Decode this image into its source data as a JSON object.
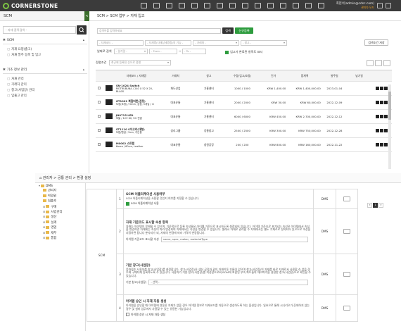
{
  "header": {
    "logo_text": "CORNERSTONE",
    "user_name": "최현석(admin@cdsc.com)",
    "user_sub": "관리자 모드",
    "menu_icons": [
      "grid-icon",
      "monitor-icon",
      "doc-icon",
      "truck-icon",
      "box-icon",
      "chart-icon",
      "calendar-icon",
      "money-icon",
      "car-icon",
      "people-icon",
      "layers-icon",
      "cart-icon",
      "gear-icon",
      "user-icon",
      "message-icon"
    ],
    "accent": "#2e9c3e",
    "bg": "#3b3b3b"
  },
  "left": {
    "title": "SCM",
    "collapse_tab": "<",
    "search_placeholder": "- 자재 품목검색 -",
    "sections": [
      {
        "label": "SCM",
        "items": [
          {
            "label": "자재 요청(출고)"
          },
          {
            "label": "자재 발주 등록 및 입고"
          }
        ]
      },
      {
        "label": "기초 정보 관리",
        "items": [
          {
            "label": "자재 관리"
          },
          {
            "label": "거래처 관리"
          },
          {
            "label": "창고(사업장) 관리"
          },
          {
            "label": "입출고 관리"
          }
        ]
      }
    ]
  },
  "breadcrumb": "SCM > SCM 업무 > 자재 입고",
  "filters": {
    "search_placeholder": "검색어를 입력하세요",
    "search_btn": "검색",
    "register_btn": "신규등록",
    "f1": "- 자재코드 -",
    "f2": "- 자재명(자재상세명칭)의 기능 -",
    "f3": "- 거래처 -",
    "f4": "- 창고 -",
    "reset_btn": "검색조건 저장",
    "date_label": "날짜로 검색",
    "date_sel": "- 날기일 -",
    "from": "- From -",
    "tilde": "~",
    "to": "- To -",
    "chk_label": "입고가 완료된 항목도 표시",
    "sort_label": "정렬조건",
    "sort_sel": "최근에 등록된 순으로 정렬",
    "tool_icons": [
      "refresh-icon",
      "print-icon",
      "excel-icon"
    ]
  },
  "table": {
    "headers": [
      "",
      "",
      "자재코드 / 자재명",
      "거래처",
      "창고",
      "수량(입고/요청)",
      "단가",
      "합계액",
      "발주일",
      "납기일",
      ""
    ],
    "rows": [
      {
        "code": "SN-1024 Switch",
        "name": "MOTRUBUNA / 240 X 52 X 20, BLACK",
        "vendor": "화도산업",
        "wh": "기흥센터",
        "qty": "1000 / 1000",
        "price": "KRW 1,400.00",
        "total": "KRW 1,400,000.00",
        "date": "2023-01-04",
        "due": ""
      },
      {
        "code": "GT1001 복합버튼(검정)",
        "name": "도정(초정) / 5mm, 검정, 5개입 / 소",
        "vendor": "대표유통",
        "wh": "기흥센터",
        "qty": "2000 / 2000",
        "price": "KRW 30.00",
        "total": "KRW 60,000.00",
        "date": "2022-12-09",
        "due": ""
      },
      {
        "code": "JN0715 LED",
        "name": "모듈 / 12V 60, 5G 전압",
        "vendor": "대표유통",
        "wh": "기흥센터",
        "qty": "6000 / 6000",
        "price": "KRW 450.00",
        "total": "KRW 2,700,000.00",
        "date": "2022-12-12",
        "due": ""
      },
      {
        "code": "ST1110 S자고리(대형)",
        "name": "도립/팬섭 / 5cm, 가든용",
        "vendor": "성리그룹",
        "wh": "강릉창고",
        "qty": "2500 / 2500",
        "price": "KRW 300.00",
        "total": "KRW 750,000.00",
        "date": "2022-12-28",
        "due": ""
      },
      {
        "code": "M0002 스트랩",
        "name": "Korea / 60cm, Leather",
        "vendor": "대표유통",
        "wh": "창원공장",
        "qty": "200 / 200",
        "price": "KRW 800.00",
        "total": "KRW 160,000.00",
        "date": "2022-11-22",
        "due": ""
      }
    ]
  },
  "overlay": {
    "breadcrumb": "관리자 > 공통 관리 > 환경 설정",
    "tree": [
      {
        "label": "DMS",
        "icon": "folder-icon",
        "depth": 0,
        "toggle": "▾"
      },
      {
        "label": "관리자",
        "icon": "folder-icon",
        "depth": 1,
        "toggle": ""
      },
      {
        "label": "박경원",
        "icon": "folder-icon",
        "depth": 1,
        "toggle": ""
      },
      {
        "label": "침출후",
        "icon": "folder-icon",
        "depth": 1,
        "toggle": ""
      },
      {
        "label": "구매",
        "icon": "folder-icon",
        "depth": 1,
        "toggle": "⊞"
      },
      {
        "label": "사업관리",
        "icon": "folder-icon",
        "depth": 1,
        "toggle": "⊞"
      },
      {
        "label": "생산",
        "icon": "folder-icon",
        "depth": 1,
        "toggle": "⊞"
      },
      {
        "label": "설계",
        "icon": "folder-icon",
        "depth": 1,
        "toggle": "⊞"
      },
      {
        "label": "영업",
        "icon": "folder-icon",
        "depth": 1,
        "toggle": "⊞"
      },
      {
        "label": "재무",
        "icon": "folder-icon",
        "depth": 1,
        "toggle": "⊞"
      },
      {
        "label": "통합",
        "icon": "folder-icon",
        "depth": 1,
        "toggle": "⊞"
      }
    ],
    "group_label": "SCM",
    "settings": [
      {
        "no": "1",
        "title": "SCM 어플리케이션 사용여부",
        "desc": "SCM 어플리케이션을 사용할 것인지 여부를 지정할 수 있습니다.",
        "check_label": "SCM 어플리케이션 사용",
        "checked": true,
        "field_label": "",
        "field_value": "",
        "scope": "DMS"
      },
      {
        "no": "2",
        "title": "자재 기준코드 표시할 속성 항목",
        "desc": "자재는 아이템의 문제될 수 있으며, 기준목으로 등록 속성들은 아이템 기준으로 표시하도록 설정되어 있습니다. 아이템 기준으로 표기되는 속성은 아이템에서 속성을 변경하면 자재에는 속성이 따라 변경되며 자재에서는 속성을 변경할 수 없습니다. 셀레시 자재로 관리할 수 자재에서는 별도 기재로로 정의되어 있으므로 속성을 지정하면 됩니다 뿐사지가 되, 자재의 변경에 따라 가격이 변경됩니다.",
        "check_label": "",
        "checked": false,
        "field_label": "아이템 기준코드 표시할 속성",
        "field_value": "name, spec, maker, materialType",
        "scope": "DMS"
      },
      {
        "no": "3",
        "title": "기본 창고(사업장)",
        "desc": "응대정순 사용자를 창고(사업장)를 설정합니다. 창고(사업장)은 생산 공정과 같이 자재이동 흐름이 있으며 창고(사업장)의 자재를 바로 자재로서 사용할 수 없음 경우에 구매자재 등록하도록 수 있습니다. 사용자가 기본 창고(사업장)를 지정함으로써 BOM에 포함된 부속 파트들의 재고파악을 설정한 창고(사업장)으로 확인할 수 있습니다.",
        "check_label": "",
        "checked": false,
        "field_label": "기본 창고(사업장)",
        "field_value": "- 선택 -",
        "scope": "DMS"
      },
      {
        "no": "4",
        "title": "아이템 승인 시 자재 자동 생성",
        "desc": "아이템을 승인할 때 아이템에 연동된 자재가 없을 경우 아이템 정보로 자재코드를 자동으로 생성하도록 하는 옵션입니다. 일요으로 통해 시니리오가 준재하지 않는 경우 및 설비 업무에서 사용할 수 있는 유용한 기능입니다.",
        "check_label": "아이템 승인 시 자재 자동 생성",
        "checked": false,
        "field_label": "",
        "field_value": "",
        "scope": "DMS"
      }
    ],
    "pager": [
      "«",
      "1",
      "»"
    ]
  }
}
